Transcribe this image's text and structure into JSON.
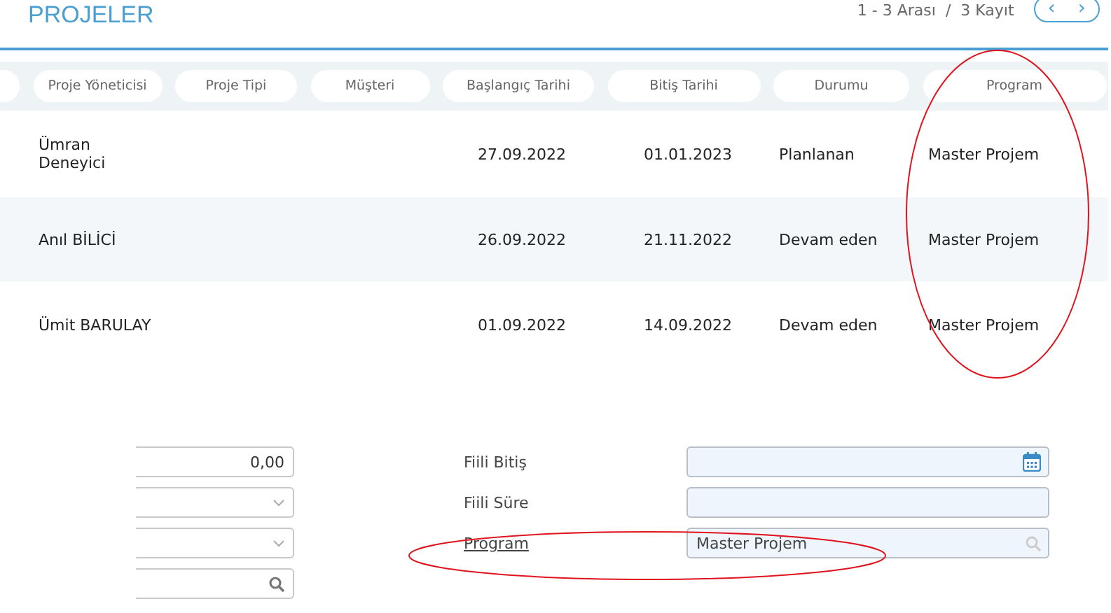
{
  "title": "PROJELER",
  "pager": {
    "summary": "1 - 3 Arası  /  3 Kayıt",
    "prev": "‹",
    "next": "›"
  },
  "table": {
    "columns": [
      "Proje Yöneticisi",
      "Proje Tipi",
      "Müşteri",
      "Başlangıç Tarihi",
      "Bitiş Tarihi",
      "Durumu",
      "Program"
    ],
    "rows": [
      {
        "manager": "Ümran\nDeneyici",
        "start": "27.09.2022",
        "end": "01.01.2023",
        "status": "Planlanan",
        "program": "Master Projem"
      },
      {
        "manager": "Anıl BİLİCİ",
        "start": "26.09.2022",
        "end": "21.11.2022",
        "status": "Devam eden",
        "program": "Master Projem"
      },
      {
        "manager": "Ümit BARULAY",
        "start": "01.09.2022",
        "end": "14.09.2022",
        "status": "Devam eden",
        "program": "Master Projem"
      }
    ]
  },
  "left_fields": [
    {
      "kind": "number",
      "value": "0,00"
    },
    {
      "kind": "select"
    },
    {
      "kind": "select"
    },
    {
      "kind": "lookup"
    }
  ],
  "right_fields": [
    {
      "label": "Fiili Bitiş",
      "link": false,
      "kind": "date"
    },
    {
      "label": "Fiili Süre",
      "link": false,
      "kind": "text"
    },
    {
      "label": "Program",
      "link": true,
      "kind": "lookup",
      "value": "Master Projem"
    }
  ]
}
